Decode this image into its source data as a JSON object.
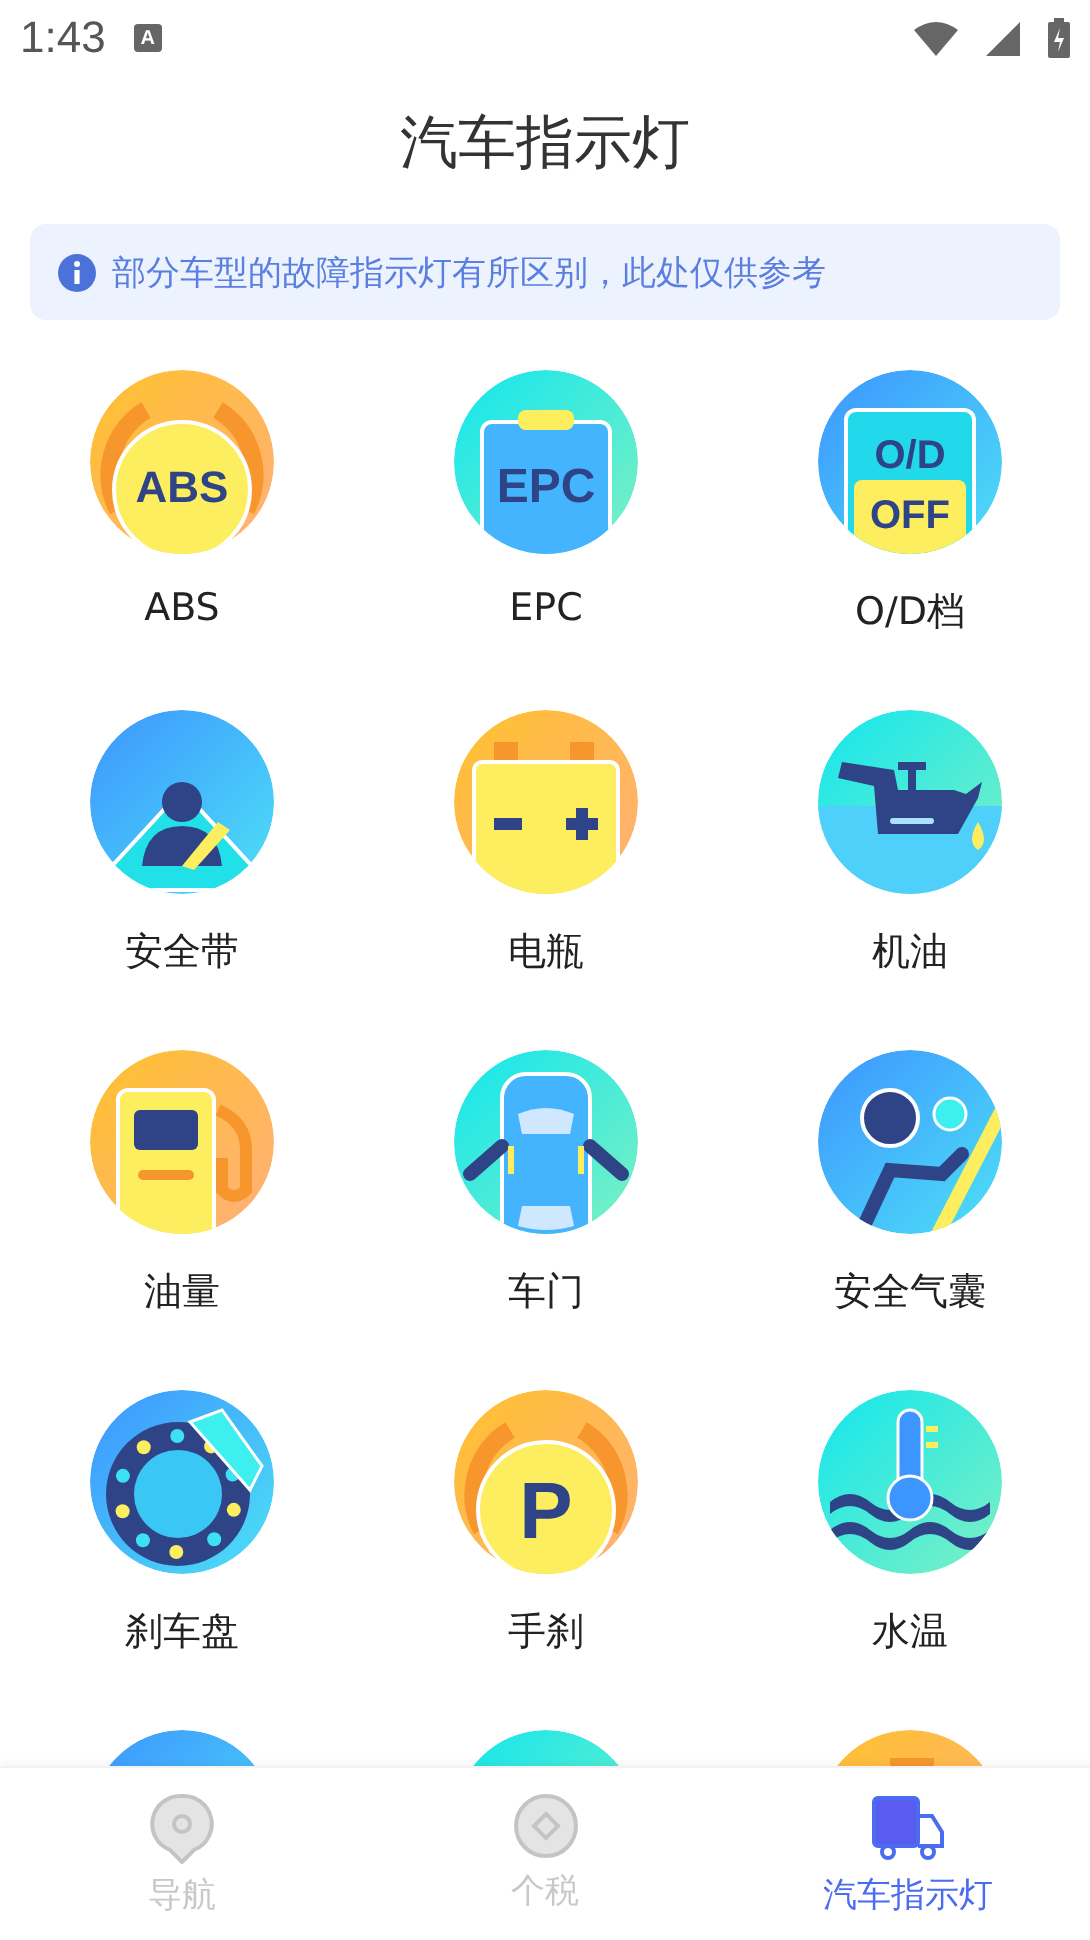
{
  "status_bar": {
    "time": "1:43",
    "notification_letter": "A"
  },
  "title": "汽车指示灯",
  "notice": "部分车型的故障指示灯有所区别，此处仅供参考",
  "indicators": [
    {
      "kind": "abs",
      "label": "ABS",
      "icon_text": [
        "ABS"
      ]
    },
    {
      "kind": "epc",
      "label": "EPC",
      "icon_text": [
        "EPC"
      ]
    },
    {
      "kind": "od",
      "label": "O/D档",
      "icon_text": [
        "O/D",
        "OFF"
      ]
    },
    {
      "kind": "seatbelt",
      "label": "安全带"
    },
    {
      "kind": "battery",
      "label": "电瓶"
    },
    {
      "kind": "oil",
      "label": "机油"
    },
    {
      "kind": "fuel",
      "label": "油量"
    },
    {
      "kind": "door",
      "label": "车门"
    },
    {
      "kind": "airbag",
      "label": "安全气囊"
    },
    {
      "kind": "brakedisc",
      "label": "刹车盘"
    },
    {
      "kind": "handbrake",
      "label": "手刹",
      "icon_text": [
        "P"
      ]
    },
    {
      "kind": "watertemp",
      "label": "水温"
    },
    {
      "kind": "partialblue"
    },
    {
      "kind": "partialcyan"
    },
    {
      "kind": "partialorange"
    }
  ],
  "nav": [
    {
      "kind": "pin",
      "label": "导航",
      "selected": false
    },
    {
      "kind": "coin",
      "label": "个税",
      "selected": false
    },
    {
      "kind": "truck",
      "label": "汽车指示灯",
      "selected": true
    }
  ]
}
